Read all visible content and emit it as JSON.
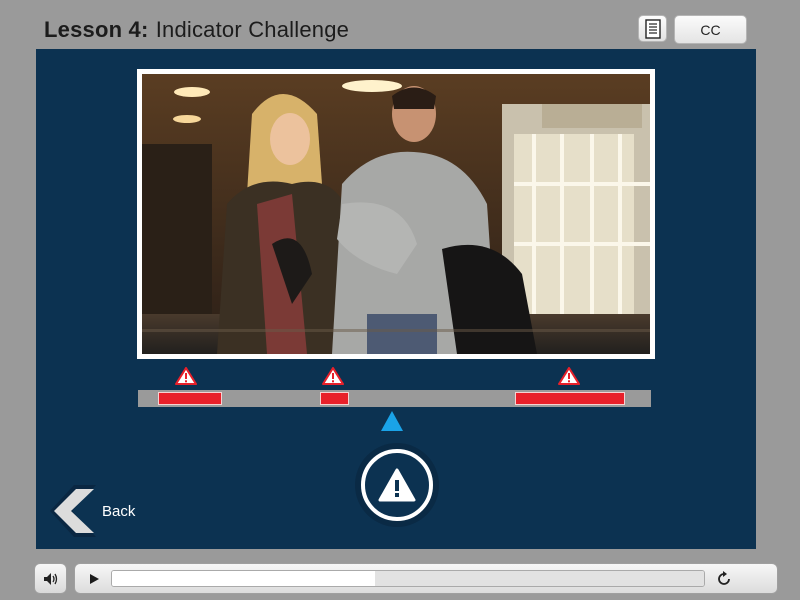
{
  "header": {
    "lesson_label": "Lesson 4:",
    "lesson_name": "Indicator Challenge",
    "cc_label": "CC",
    "transcript_icon": "document-icon"
  },
  "stage": {
    "video_description_icon": "video-frame",
    "timeline": {
      "segments": [
        {
          "start": 0.04,
          "end": 0.162
        },
        {
          "start": 0.356,
          "end": 0.41
        },
        {
          "start": 0.735,
          "end": 0.948
        }
      ],
      "markers": [
        0.093,
        0.38,
        0.843
      ],
      "playhead": 0.495
    },
    "alert_button_icon": "warning-icon",
    "back_label": "Back"
  },
  "player": {
    "volume_icon": "speaker-icon",
    "play_icon": "play-icon",
    "progress": 0.445,
    "replay_icon": "replay-icon"
  },
  "colors": {
    "stage_bg": "#0c3251",
    "segment_red": "#e8202a",
    "playhead_blue": "#1aa3e8",
    "page_bg": "#9a9a9a"
  }
}
